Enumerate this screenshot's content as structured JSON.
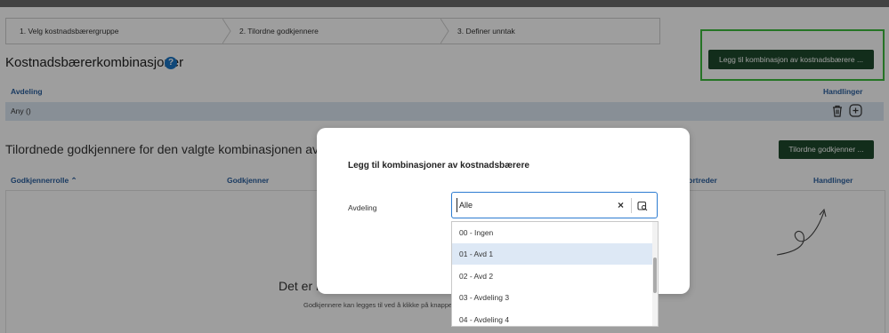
{
  "stepper": {
    "steps": [
      "1. Velg kostnadsbærergruppe",
      "2. Tilordne godkjennere",
      "3. Definer unntak"
    ]
  },
  "combinations": {
    "title": "Kostnadsbærerkombinasjoner",
    "help_icon": "?",
    "add_button": "Legg til kombinasjon av kostnadsbærere ...",
    "columns": {
      "department": "Avdeling",
      "actions": "Handlinger"
    },
    "rows": [
      {
        "department": "Any ()"
      }
    ]
  },
  "approvers": {
    "title": "Tilordnede godkjennere for den valgte kombinasjonen av kostnadsbærere",
    "assign_button": "Tilordne godkjenner ...",
    "columns": {
      "role": "Godkjennerrolle ⌃",
      "approver": "Godkjenner",
      "substitute": "Stedfortreder",
      "actions": "Handlinger"
    },
    "empty_title": "Det er ingen godkjennere",
    "empty_text": "Godkjennere kan legges til ved å klikke på knappen Tilordne godkjenner"
  },
  "modal": {
    "title": "Legg til kombinasjoner av kostnadsbærere",
    "field_label": "Avdeling",
    "field_value": "Alle",
    "clear_glyph": "×",
    "options": [
      "00 - Ingen",
      "01 - Avd 1",
      "02 - Avd 2",
      "03 - Avdeling 3",
      "04 - Avdeling 4"
    ],
    "selected_index": 1
  },
  "colors": {
    "button_green": "#1e4a2c",
    "highlight": "#3dbb3d",
    "link_blue": "#2a5f9e",
    "row_selected": "#dce7f2",
    "focus_border": "#2d7cd1"
  },
  "icons": [
    "help-icon",
    "trash-icon",
    "add-circle-icon",
    "clear-icon",
    "lookup-icon",
    "empty-state-illustration"
  ]
}
